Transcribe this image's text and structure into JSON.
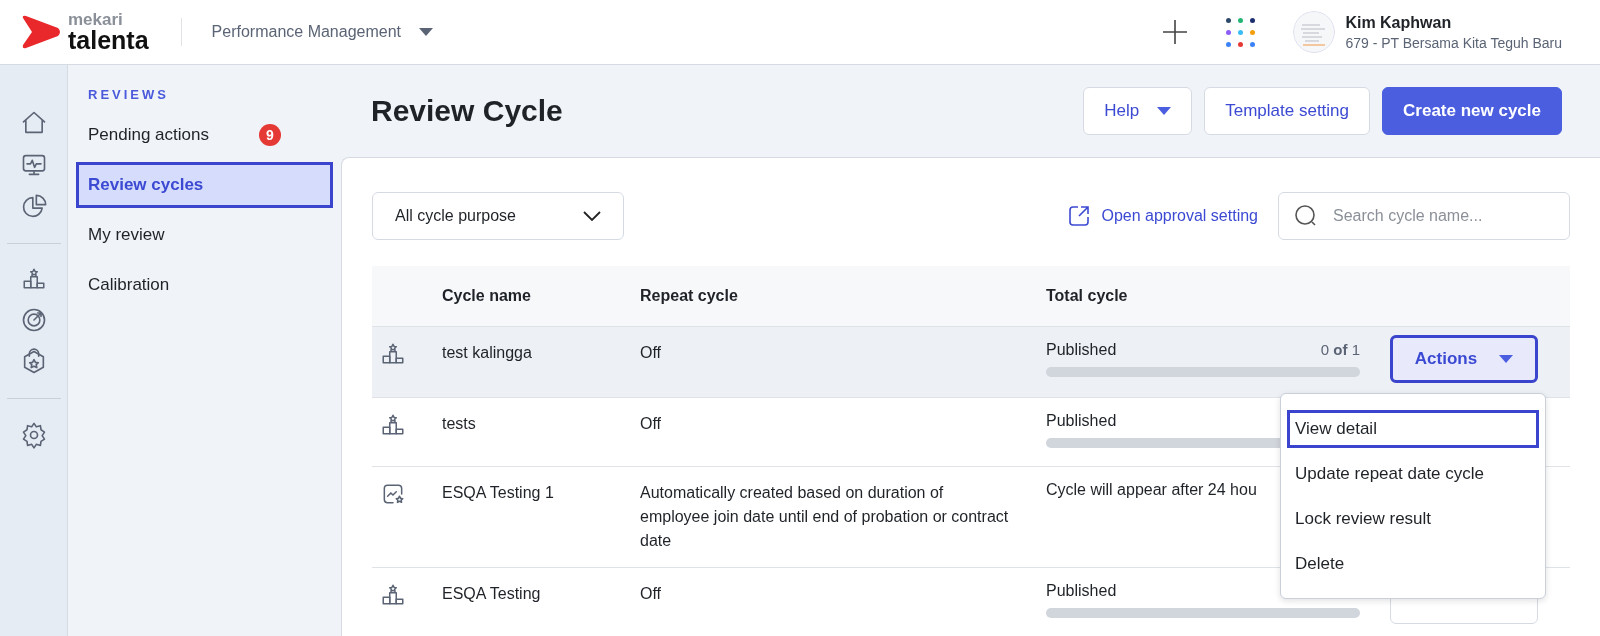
{
  "logo": {
    "top": "mekari",
    "bottom": "talenta"
  },
  "product_switcher": {
    "label": "Performance Management"
  },
  "user": {
    "name": "Kim Kaphwan",
    "company": "679 - PT Bersama Kita Teguh Baru"
  },
  "sidebar": {
    "section": "REVIEWS",
    "items": [
      {
        "label": "Pending actions",
        "badge": "9",
        "selected": false
      },
      {
        "label": "Review cycles",
        "selected": true
      },
      {
        "label": "My review",
        "selected": false
      },
      {
        "label": "Calibration",
        "selected": false
      }
    ]
  },
  "page": {
    "title": "Review Cycle",
    "buttons": [
      {
        "label": "Help",
        "kind": "dropdown"
      },
      {
        "label": "Template setting",
        "kind": "secondary"
      },
      {
        "label": "Create new cycle",
        "kind": "primary"
      }
    ]
  },
  "filter": {
    "value": "All cycle purpose"
  },
  "approval_link": "Open approval setting",
  "search": {
    "placeholder": "Search cycle name..."
  },
  "table": {
    "columns": [
      "Cycle name",
      "Repeat cycle",
      "Total cycle"
    ],
    "rows": [
      {
        "kind": "manual",
        "name": "test kalingga",
        "repeat": "Off",
        "status": "Published",
        "count": "0 **of** 1",
        "actions": "Actions",
        "selected": true
      },
      {
        "kind": "manual",
        "name": "tests",
        "repeat": "Off",
        "status": "Published",
        "selected": false
      },
      {
        "kind": "automatic",
        "name": "ESQA Testing 1",
        "repeat": "Automatically created based on duration of employee join date until end of probation or contract date",
        "status": "Cycle will appear after 24 hou",
        "selected": false
      },
      {
        "kind": "manual",
        "name": "ESQA Testing",
        "repeat": "Off",
        "status": "Published",
        "action_button": true,
        "selected": false
      }
    ]
  },
  "actions_menu": {
    "items": [
      {
        "label": "View detail",
        "selected": true
      },
      {
        "label": "Update repeat date cycle",
        "selected": false
      },
      {
        "label": "Lock review result",
        "selected": false
      },
      {
        "label": "Delete",
        "selected": false
      }
    ]
  }
}
